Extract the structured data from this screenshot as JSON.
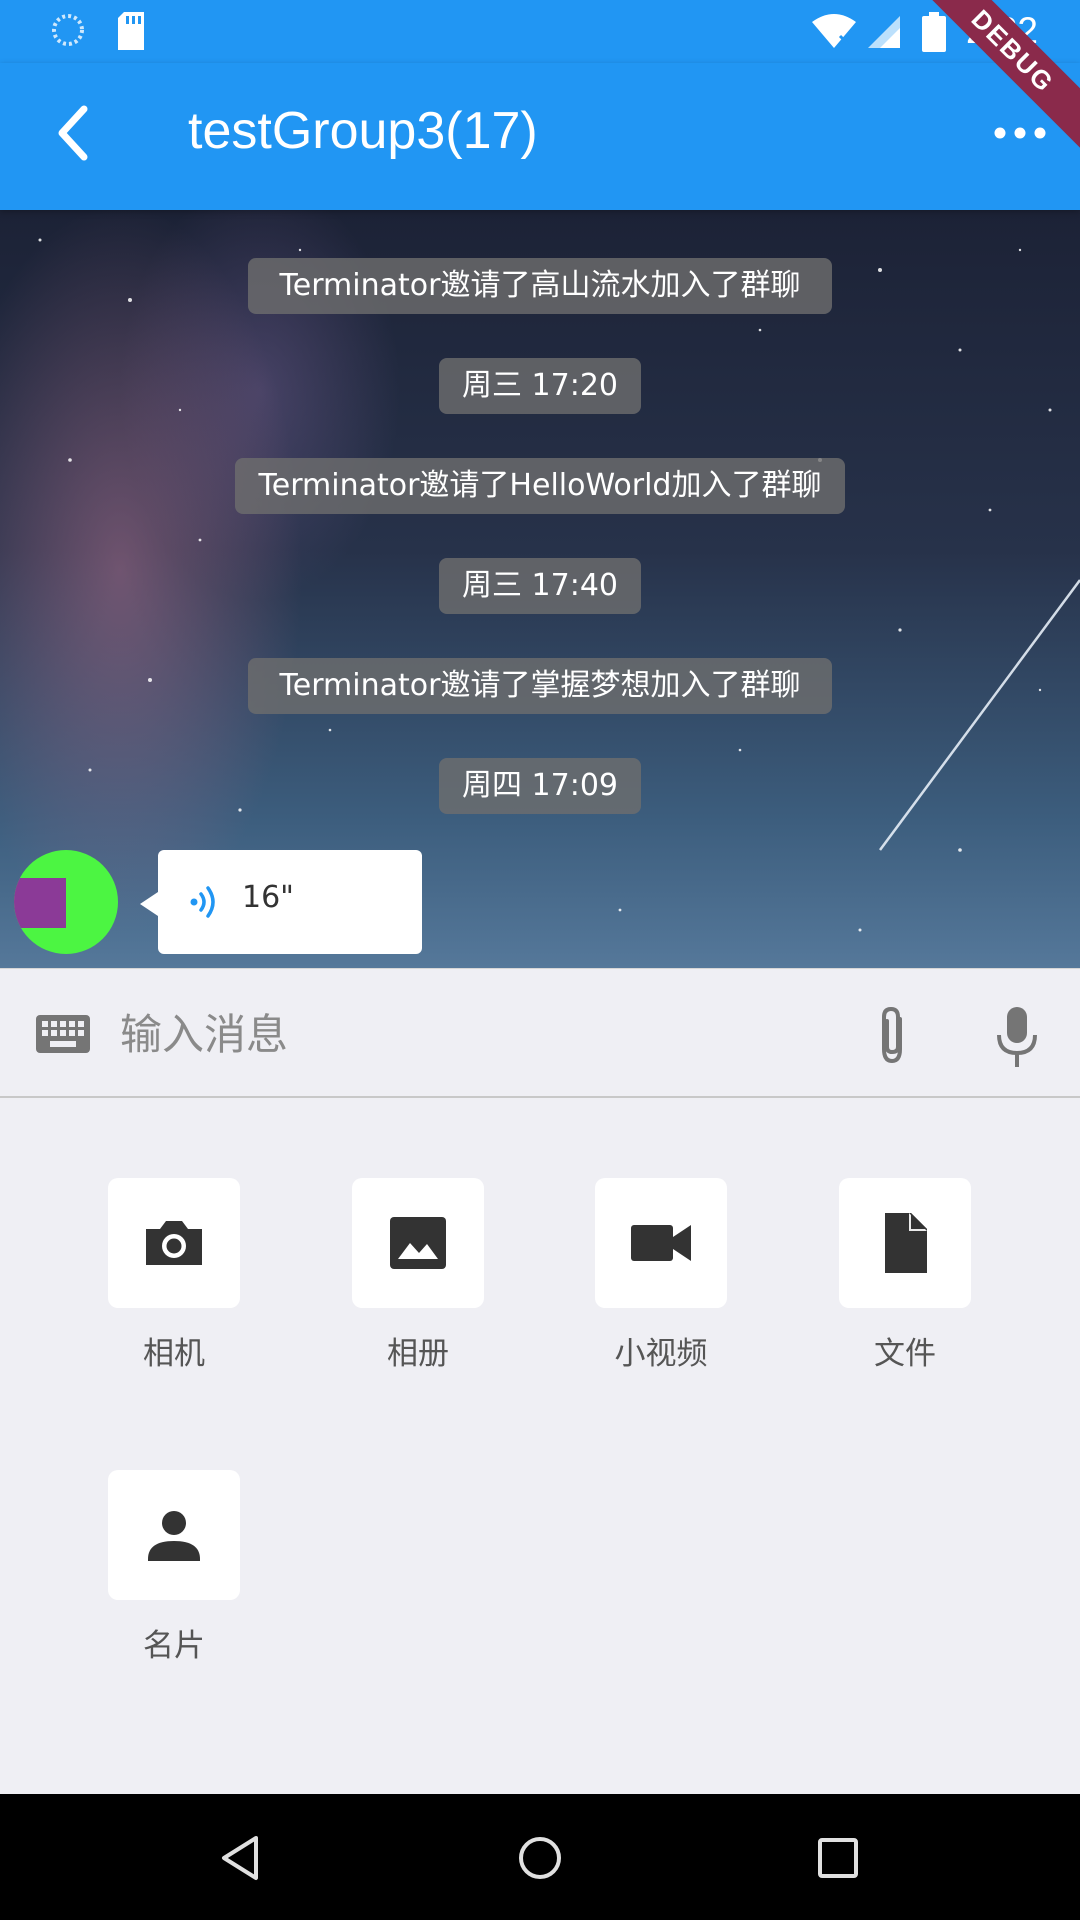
{
  "status_bar": {
    "time": "2:22",
    "debug_label": "DEBUG",
    "icons": [
      "loading-circle-icon",
      "sd-card-icon",
      "wifi-icon",
      "signal-icon",
      "battery-icon"
    ]
  },
  "app_bar": {
    "title": "testGroup3(17)",
    "back_icon": "back-arrow-icon",
    "more_icon": "more-horizontal-icon"
  },
  "messages": [
    {
      "type": "system",
      "text": "Terminator邀请了高山流水加入了群聊"
    },
    {
      "type": "time",
      "text": "周三 17:20"
    },
    {
      "type": "system",
      "text": "Terminator邀请了HelloWorld加入了群聊"
    },
    {
      "type": "time",
      "text": "周三 17:40"
    },
    {
      "type": "system",
      "text": "Terminator邀请了掌握梦想加入了群聊"
    },
    {
      "type": "time",
      "text": "周四 17:09"
    }
  ],
  "voice_message": {
    "duration": "16\"",
    "icon": "voice-wave-icon"
  },
  "input_bar": {
    "placeholder": "输入消息",
    "keyboard_icon": "keyboard-icon",
    "attach_icon": "paperclip-icon",
    "mic_icon": "microphone-icon"
  },
  "actions": [
    {
      "label": "相机",
      "icon": "camera-icon"
    },
    {
      "label": "相册",
      "icon": "image-icon"
    },
    {
      "label": "小视频",
      "icon": "video-camera-icon"
    },
    {
      "label": "文件",
      "icon": "file-icon"
    },
    {
      "label": "名片",
      "icon": "person-icon"
    }
  ],
  "colors": {
    "primary": "#2196f3",
    "panel_bg": "#efeff4",
    "avatar_green": "#4cf542",
    "avatar_purple": "#8b3a97",
    "voice_blue": "#2196f3"
  }
}
